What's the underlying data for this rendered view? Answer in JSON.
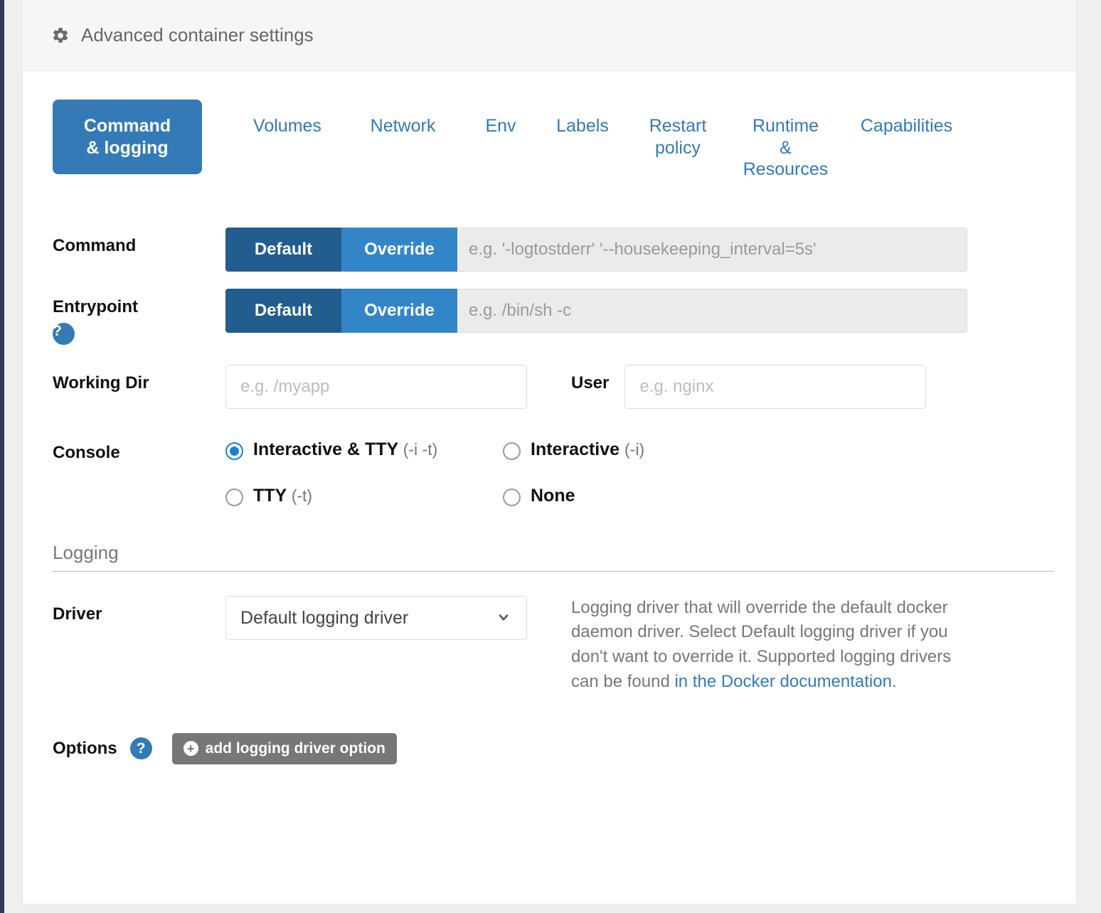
{
  "panel": {
    "header_title": "Advanced container settings",
    "header_icon": "gear-icon"
  },
  "tabs": [
    {
      "label": "Command\n& logging",
      "active": true
    },
    {
      "label": "Volumes",
      "active": false
    },
    {
      "label": "Network",
      "active": false
    },
    {
      "label": "Env",
      "active": false
    },
    {
      "label": "Labels",
      "active": false
    },
    {
      "label": "Restart\npolicy",
      "active": false
    },
    {
      "label": "Runtime\n&\nResources",
      "active": false
    },
    {
      "label": "Capabilities",
      "active": false
    }
  ],
  "form": {
    "command": {
      "label": "Command",
      "default_label": "Default",
      "override_label": "Override",
      "selected": "Default",
      "placeholder": "e.g. '-logtostderr' '--housekeeping_interval=5s'",
      "value": ""
    },
    "entrypoint": {
      "label": "Entrypoint",
      "help_icon": "help-icon",
      "default_label": "Default",
      "override_label": "Override",
      "selected": "Default",
      "placeholder": "e.g. /bin/sh -c",
      "value": ""
    },
    "working_dir": {
      "label": "Working Dir",
      "placeholder": "e.g. /myapp",
      "value": ""
    },
    "user": {
      "label": "User",
      "placeholder": "e.g. nginx",
      "value": ""
    },
    "console": {
      "label": "Console",
      "options": [
        {
          "text": "Interactive & TTY ",
          "flag": "(-i -t)",
          "checked": true
        },
        {
          "text": "Interactive ",
          "flag": "(-i)",
          "checked": false
        },
        {
          "text": "TTY ",
          "flag": "(-t)",
          "checked": false
        },
        {
          "text": "None",
          "flag": "",
          "checked": false
        }
      ]
    }
  },
  "logging": {
    "section_title": "Logging",
    "driver": {
      "label": "Driver",
      "selected": "Default logging driver",
      "options": [
        "Default logging driver"
      ],
      "help_text_1": "Logging driver that will override the default docker daemon driver. Select Default logging driver if you don't want to override it. Supported logging drivers can be found ",
      "help_link": "in the Docker documentation.",
      "dropdown_icon": "chevron-down-icon"
    },
    "options": {
      "label": "Options",
      "help_icon": "help-icon",
      "add_button_label": "add logging driver option",
      "add_button_icon": "plus-circle-icon"
    }
  },
  "colors": {
    "accent": "#337ab7",
    "toggle_active": "#215d8f",
    "toggle_inactive": "#3286c8",
    "radio_checked": "#1a7fd4",
    "add_button_bg": "#777777",
    "header_bg": "#f6f6f6"
  }
}
